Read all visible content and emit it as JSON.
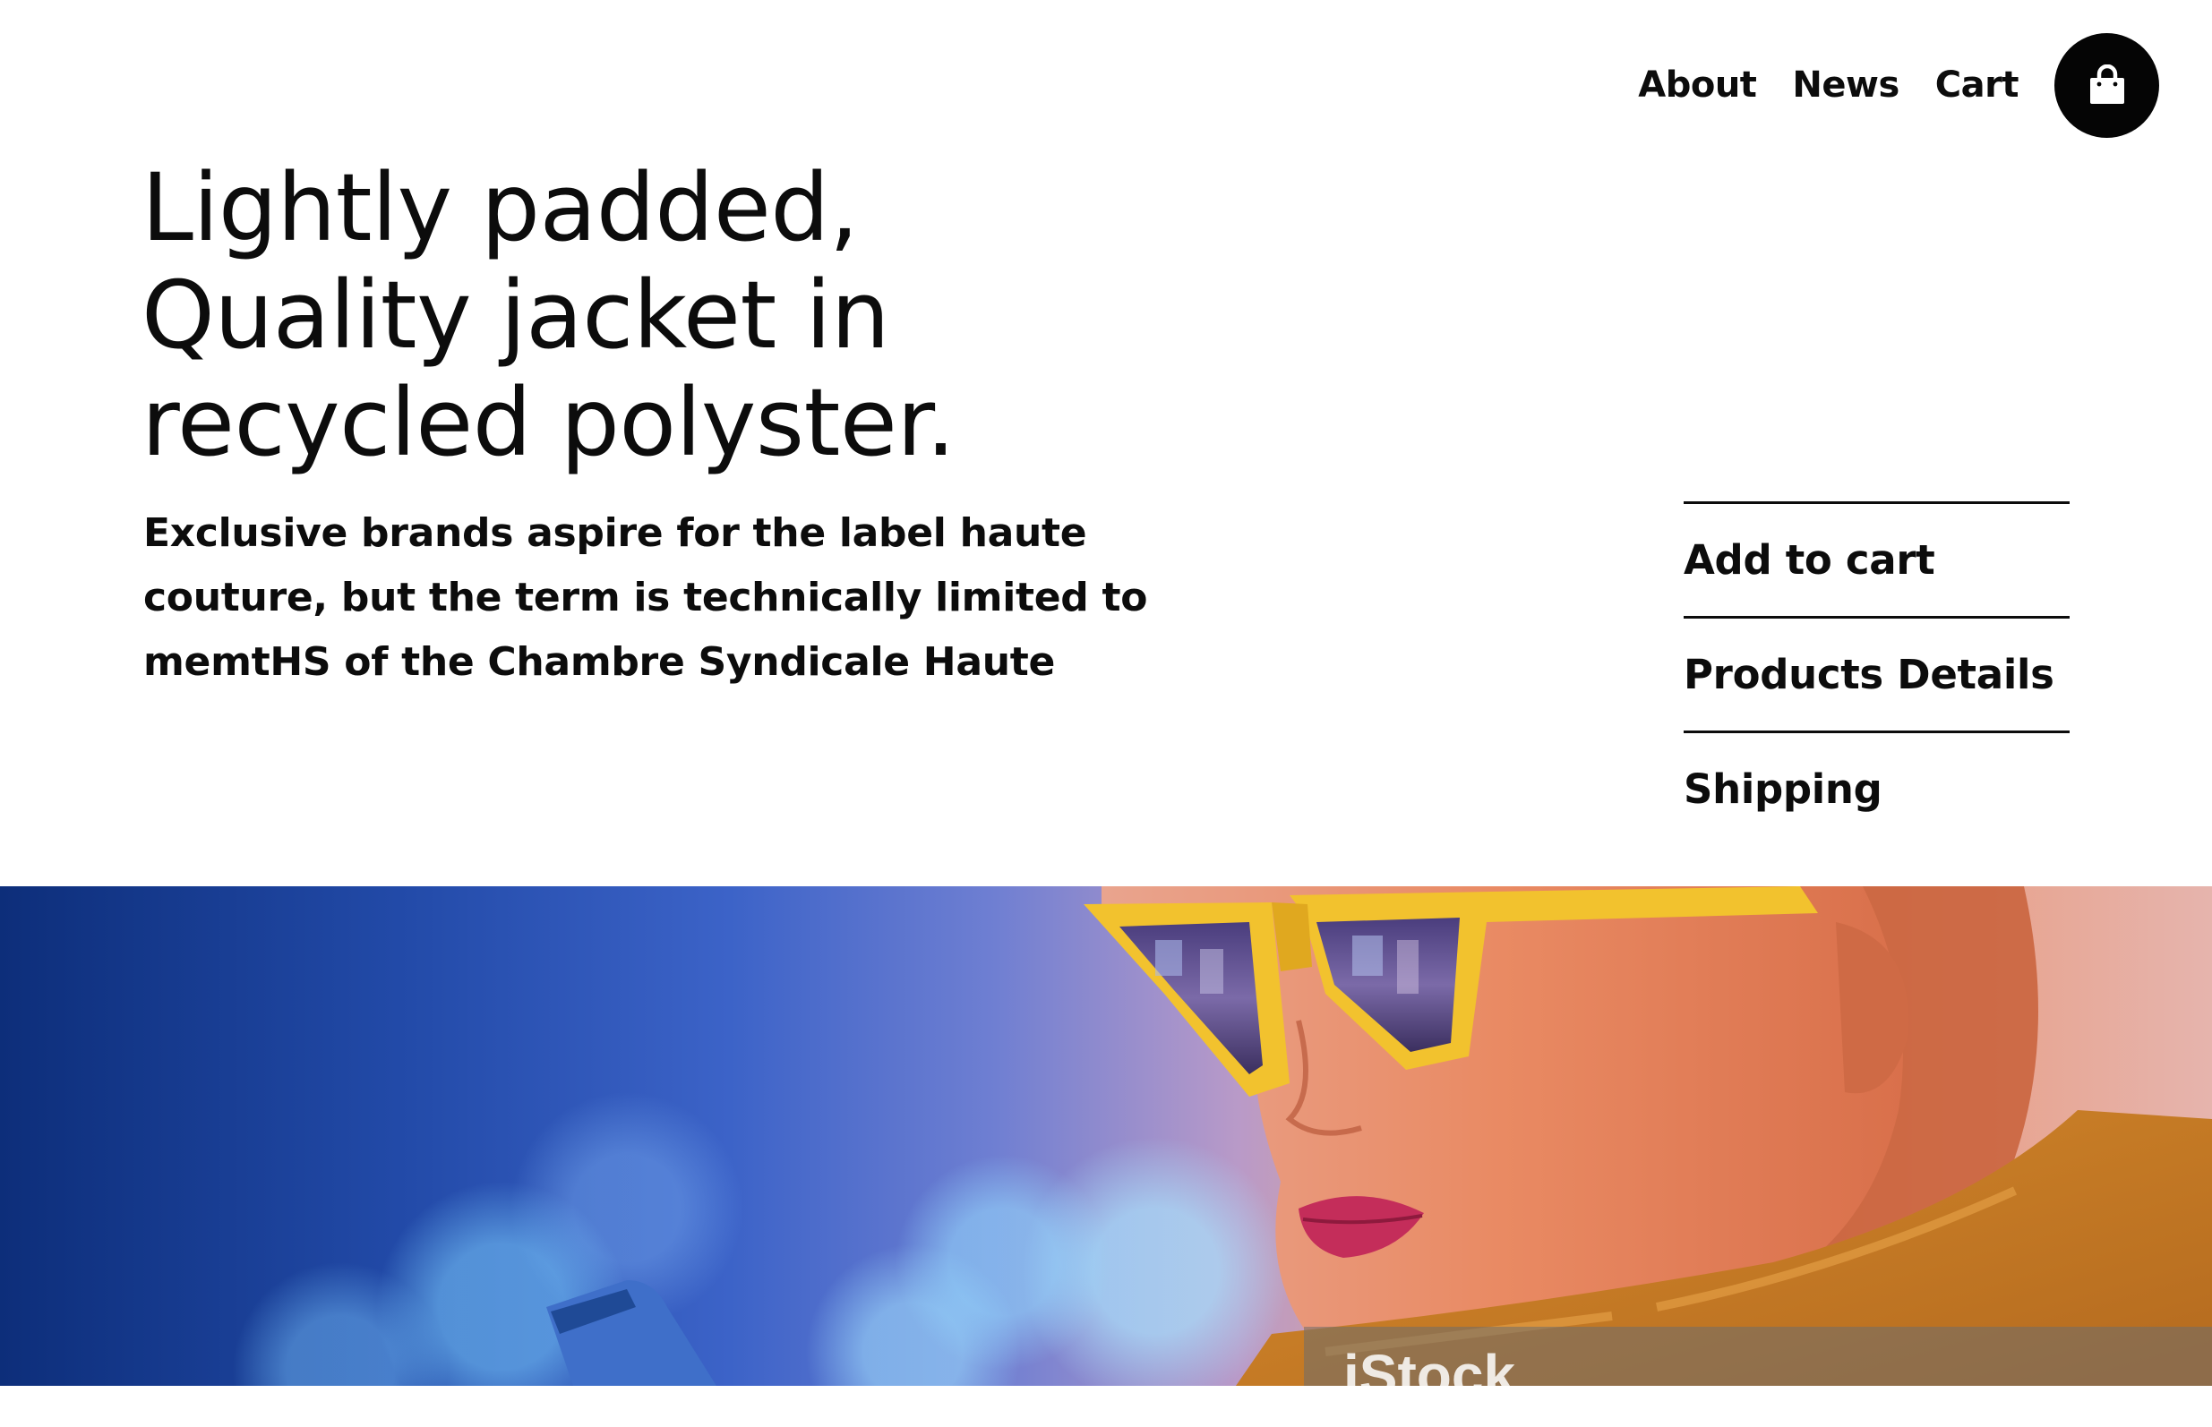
{
  "nav": {
    "links": [
      "About",
      "News",
      "Cart"
    ],
    "bag_icon": "shopping-bag-icon"
  },
  "hero": {
    "title_lines": [
      "Lightly padded,",
      "Quality jacket in",
      "recycled polyster."
    ],
    "description_lines": [
      "Exclusive brands aspire for the label haute",
      "couture, but the term is technically limited to",
      "memtHS of the Chambre Syndicale Haute"
    ]
  },
  "actions": {
    "items": [
      "Add to cart",
      "Products Details",
      "Shipping"
    ]
  },
  "image": {
    "subject": "woman-with-yellow-sunglasses-photo",
    "watermark": "iStock"
  },
  "colors": {
    "text": "#0c0c0c",
    "bag_button": "#050505",
    "background": "#ffffff",
    "sunglasses": "#f2c22e"
  }
}
